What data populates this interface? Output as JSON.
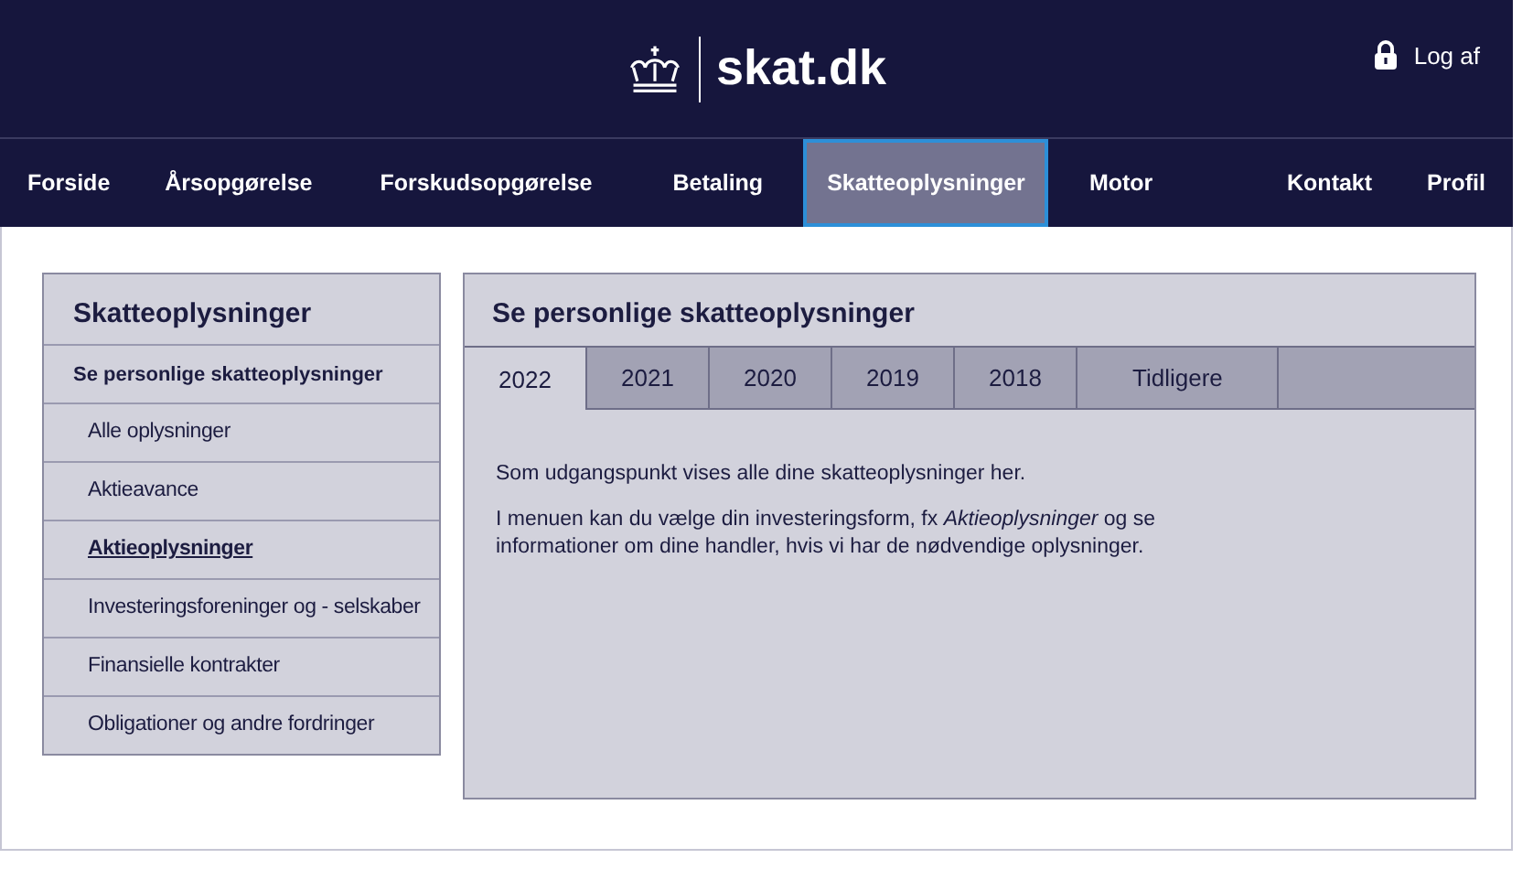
{
  "header": {
    "logo_text": "skat.dk",
    "logout": "Log af"
  },
  "nav": {
    "left": [
      {
        "label": "Forside",
        "selected": false
      },
      {
        "label": "Årsopgørelse",
        "selected": false
      },
      {
        "label": "Forskudsopgørelse",
        "selected": false
      },
      {
        "label": "Betaling",
        "selected": false
      },
      {
        "label": "Skatteoplysninger",
        "selected": true
      },
      {
        "label": "Motor",
        "selected": false
      }
    ],
    "right": [
      {
        "label": "Kontakt",
        "selected": false
      },
      {
        "label": "Profil",
        "selected": false
      }
    ]
  },
  "sidebar": {
    "title": "Skatteoplysninger",
    "items": [
      {
        "label": "Se personlige skatteoplysninger",
        "children": [
          {
            "label": "Alle oplysninger",
            "selected": false
          },
          {
            "label": "Aktieavance",
            "selected": false
          },
          {
            "label": "Aktieoplysninger",
            "selected": true
          },
          {
            "label": "Investeringsforeninger og - selskaber",
            "selected": false
          },
          {
            "label": "Finansielle kontrakter",
            "selected": false
          },
          {
            "label": "Obligationer og andre fordringer",
            "selected": false
          }
        ]
      }
    ]
  },
  "main": {
    "title": "Se personlige skatteoplysninger",
    "tabs": [
      {
        "label": "2022",
        "selected": true
      },
      {
        "label": "2021",
        "selected": false
      },
      {
        "label": "2020",
        "selected": false
      },
      {
        "label": "2019",
        "selected": false
      },
      {
        "label": "2018",
        "selected": false
      },
      {
        "label": "Tidligere",
        "selected": false
      }
    ],
    "paragraphs": [
      "Som udgangspunkt vises alle dine skatteoplysninger her.",
      "I menuen kan du vælge din investeringsform, fx *Aktieoplysninger* og se informationer om dine handler, hvis vi har de nødvendige oplysninger."
    ]
  }
}
